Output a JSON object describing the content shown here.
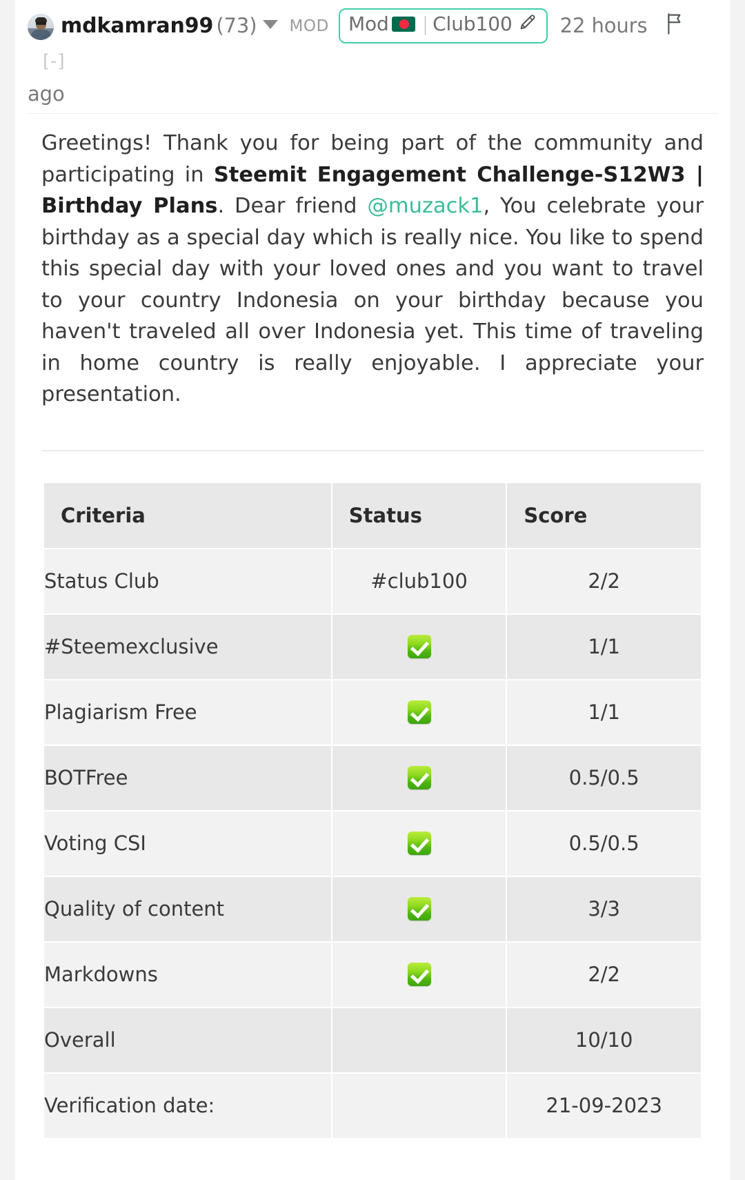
{
  "comment": {
    "author": "mdkamran99",
    "reputation": "(73)",
    "caret_icon": "chevron-down-icon",
    "mod_tag": "MOD",
    "badge": {
      "prefix": "Mod",
      "flag_icon": "bangladesh-flag-icon",
      "separator": "|",
      "suffix": "Club100",
      "pencil_icon": "pencil-icon"
    },
    "timestamp": "22 hours",
    "timestamp_suffix": "ago",
    "flag_icon": "report-flag-icon",
    "collapse_toggle": "[-]"
  },
  "body": {
    "part1": "Greetings! Thank you for being part of the community and participating in ",
    "bold_title": "Steemit Engagement Challenge-S12W3 | Birthday Plans",
    "part2": ". Dear friend ",
    "mention": "@muzack1",
    "part3": ", You celebrate your birthday as a special day which is really nice. You like to spend this special day with your loved ones and you want to travel to your country Indonesia on your birthday because you haven't traveled all over Indonesia yet. This time of traveling in home country is really enjoyable. I appreciate your presentation."
  },
  "table": {
    "headers": [
      "Criteria",
      "Status",
      "Score"
    ],
    "rows": [
      {
        "criteria": "Status Club",
        "criteria_style": "plain",
        "status": "#club100",
        "status_type": "text",
        "score": "2/2"
      },
      {
        "criteria": "#Steemexclusive",
        "criteria_style": "link",
        "status": "check",
        "status_type": "icon",
        "score": "1/1"
      },
      {
        "criteria": "Plagiarism Free",
        "criteria_style": "plain",
        "status": "check",
        "status_type": "icon",
        "score": "1/1"
      },
      {
        "criteria": "BOTFree",
        "criteria_style": "plain",
        "status": "check",
        "status_type": "icon",
        "score": "0.5/0.5"
      },
      {
        "criteria": "Voting CSI",
        "criteria_style": "plain",
        "status": "check",
        "status_type": "icon",
        "score": "0.5/0.5"
      },
      {
        "criteria": "Quality of content",
        "criteria_style": "plain",
        "status": "check",
        "status_type": "icon",
        "score": "3/3"
      },
      {
        "criteria": "Markdowns",
        "criteria_style": "plain",
        "status": "check",
        "status_type": "icon",
        "score": "2/2"
      },
      {
        "criteria": "Overall",
        "criteria_style": "plain",
        "status": "",
        "status_type": "none",
        "score": "10/10"
      },
      {
        "criteria": "Verification date:",
        "criteria_style": "plain",
        "status": "",
        "status_type": "none",
        "score": "21-09-2023"
      }
    ]
  },
  "colors": {
    "accent_green": "#3bbd96",
    "badge_border": "#3fceaa",
    "check_green": "#4fb511",
    "row_light": "#f2f2f2",
    "row_dark": "#e8e8e8",
    "header_bg": "#e8e8e8",
    "text": "#3a3a3a"
  }
}
